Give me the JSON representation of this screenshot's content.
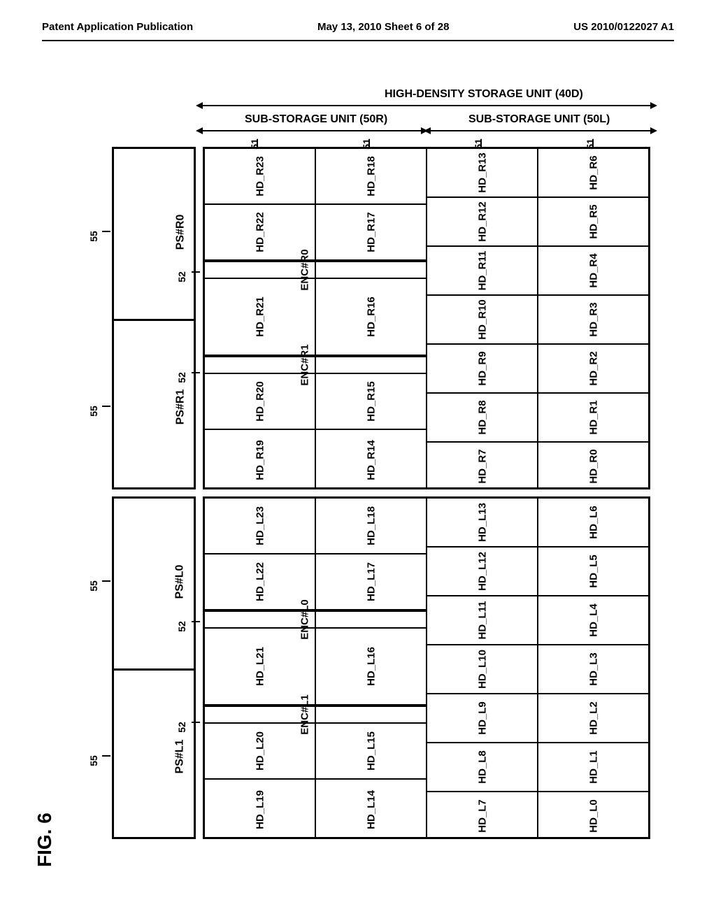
{
  "header": {
    "left": "Patent Application Publication",
    "center": "May 13, 2010  Sheet 6 of 28",
    "right": "US 2010/0122027 A1"
  },
  "figure_label": "FIG. 6",
  "top_title": "HIGH-DENSITY STORAGE UNIT (40D)",
  "sub_left_title": "SUB-STORAGE UNIT (50R)",
  "sub_right_title": "SUB-STORAGE UNIT (50L)",
  "ps_groups": [
    "PS#R0",
    "PS#R1",
    "PS#L0",
    "PS#L1"
  ],
  "enc_labels": [
    "ENC#R0",
    "ENC#R1",
    "ENC#L0",
    "ENC#L1"
  ],
  "ref_55": "55",
  "ref_52": "52",
  "ref_51": "51",
  "chart_data": {
    "type": "table",
    "title": "HIGH-DENSITY STORAGE UNIT (40D)",
    "sub_units": [
      {
        "name": "SUB-STORAGE UNIT (50R)",
        "power_supplies": [
          {
            "name": "PS#R0",
            "ref": "55",
            "enclosure": {
              "name": "ENC#R0",
              "ref": "52"
            }
          },
          {
            "name": "PS#R1",
            "ref": "55",
            "enclosure": {
              "name": "ENC#R1",
              "ref": "52"
            }
          }
        ],
        "drive_columns": [
          {
            "ref": "51",
            "drives": [
              "HD_R23",
              "HD_R22",
              "ENC#R0",
              "HD_R21",
              "ENC#R1",
              "HD_R20",
              "HD_R19"
            ]
          },
          {
            "ref": "51",
            "drives": [
              "HD_R18",
              "HD_R17",
              "ENC#R0",
              "HD_R16",
              "ENC#R1",
              "HD_R15",
              "HD_R14"
            ]
          },
          {
            "ref": "51",
            "drives": [
              "HD_R13",
              "HD_R12",
              "HD_R11",
              "HD_R10",
              "HD_R9",
              "HD_R8",
              "HD_R7"
            ]
          },
          {
            "ref": "51",
            "drives": [
              "HD_R6",
              "HD_R5",
              "HD_R4",
              "HD_R3",
              "HD_R2",
              "HD_R1",
              "HD_R0"
            ]
          }
        ]
      },
      {
        "name": "SUB-STORAGE UNIT (50L)",
        "power_supplies": [
          {
            "name": "PS#L0",
            "ref": "55",
            "enclosure": {
              "name": "ENC#L0",
              "ref": "52"
            }
          },
          {
            "name": "PS#L1",
            "ref": "55",
            "enclosure": {
              "name": "ENC#L1",
              "ref": "52"
            }
          }
        ],
        "drive_columns": [
          {
            "ref": "51",
            "drives": [
              "HD_L23",
              "HD_L22",
              "ENC#L0",
              "HD_L21",
              "ENC#L1",
              "HD_L20",
              "HD_L19"
            ]
          },
          {
            "ref": "51",
            "drives": [
              "HD_L18",
              "HD_L17",
              "ENC#L0",
              "HD_L16",
              "ENC#L1",
              "HD_L15",
              "HD_L14"
            ]
          },
          {
            "ref": "51",
            "drives": [
              "HD_L13",
              "HD_L12",
              "HD_L11",
              "HD_L10",
              "HD_L9",
              "HD_L8",
              "HD_L7"
            ]
          },
          {
            "ref": "51",
            "drives": [
              "HD_L6",
              "HD_L5",
              "HD_L4",
              "HD_L3",
              "HD_L2",
              "HD_L1",
              "HD_L0"
            ]
          }
        ]
      }
    ]
  },
  "drives": {
    "R": {
      "c1": [
        "HD_R23",
        "HD_R22",
        "HD_R21",
        "HD_R20",
        "HD_R19"
      ],
      "c2": [
        "HD_R18",
        "HD_R17",
        "HD_R16",
        "HD_R15",
        "HD_R14"
      ],
      "c3": [
        "HD_R13",
        "HD_R12",
        "HD_R11",
        "HD_R10",
        "HD_R9",
        "HD_R8",
        "HD_R7"
      ],
      "c4": [
        "HD_R6",
        "HD_R5",
        "HD_R4",
        "HD_R3",
        "HD_R2",
        "HD_R1",
        "HD_R0"
      ]
    },
    "L": {
      "c1": [
        "HD_L23",
        "HD_L22",
        "HD_L21",
        "HD_L20",
        "HD_L19"
      ],
      "c2": [
        "HD_L18",
        "HD_L17",
        "HD_L16",
        "HD_L15",
        "HD_L14"
      ],
      "c3": [
        "HD_L13",
        "HD_L12",
        "HD_L11",
        "HD_L10",
        "HD_L9",
        "HD_L8",
        "HD_L7"
      ],
      "c4": [
        "HD_L6",
        "HD_L5",
        "HD_L4",
        "HD_L3",
        "HD_L2",
        "HD_L1",
        "HD_L0"
      ]
    }
  }
}
